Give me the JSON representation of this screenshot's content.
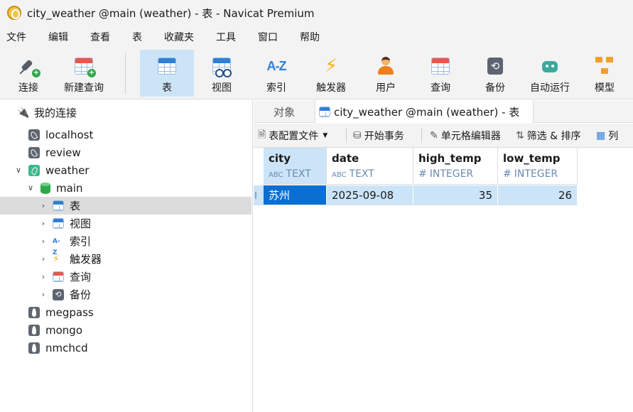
{
  "window": {
    "title": "city_weather @main (weather) - 表 - Navicat Premium"
  },
  "menu": [
    "文件",
    "编辑",
    "查看",
    "表",
    "收藏夹",
    "工具",
    "窗口",
    "帮助"
  ],
  "toolbar": {
    "connect": "连接",
    "new_query": "新建查询",
    "table": "表",
    "view": "视图",
    "index": "索引",
    "trigger": "触发器",
    "user": "用户",
    "query": "查询",
    "backup": "备份",
    "automation": "自动运行",
    "model": "模型",
    "index_icon_text": "A-Z",
    "active": "表"
  },
  "sidebar": {
    "header": "我的连接",
    "connections": [
      {
        "label": "localhost"
      },
      {
        "label": "review"
      },
      {
        "label": "weather"
      },
      {
        "label": "megpass"
      },
      {
        "label": "mongo"
      },
      {
        "label": "nmchcd"
      }
    ],
    "database": "main",
    "db_children": [
      "表",
      "视图",
      "索引",
      "触发器",
      "查询",
      "备份"
    ],
    "index_icon_text": "A-Z"
  },
  "tabs": {
    "objects": "对象",
    "active": "city_weather @main (weather) - 表"
  },
  "subtoolbar": {
    "profile": "表配置文件",
    "begin_tx": "开始事务",
    "cell_editor": "单元格编辑器",
    "filter_sort": "筛选 & 排序",
    "columns": "列"
  },
  "table": {
    "columns": [
      {
        "name": "city",
        "type": "TEXT",
        "chip": "ABC"
      },
      {
        "name": "date",
        "type": "TEXT",
        "chip": "ABC"
      },
      {
        "name": "high_temp",
        "type": "INTEGER",
        "chip": "#"
      },
      {
        "name": "low_temp",
        "type": "INTEGER",
        "chip": "#"
      }
    ],
    "rows": [
      [
        "苏州",
        "2025-09-08",
        "35",
        "26"
      ]
    ]
  }
}
